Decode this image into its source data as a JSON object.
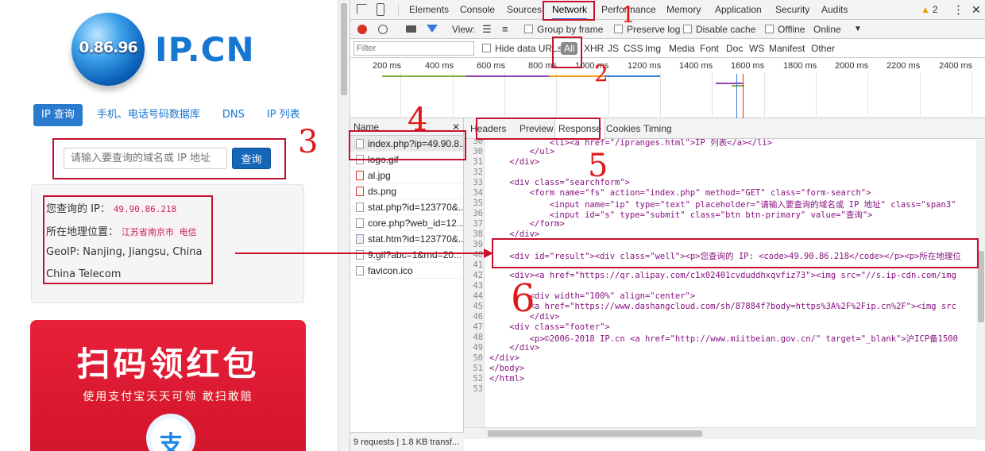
{
  "site": {
    "logo_globe_text": "0.86.96",
    "logo_text": "IP.CN",
    "nav": [
      "IP 查询",
      "手机、电话号码数据库",
      "DNS",
      "IP 列表"
    ],
    "search_placeholder": "请输入要查询的域名或 IP 地址",
    "search_button": "查询",
    "result": {
      "ip_label": "您查询的 IP：",
      "ip_value": "49.90.86.218",
      "location_label": "所在地理位置：",
      "location_value": "江苏省南京市  电信",
      "geoip": "GeoIP: Nanjing, Jiangsu, China",
      "isp": "China Telecom"
    },
    "ad": {
      "title": "扫码领红包",
      "subtitle": "使用支付宝天天可领  敢扫敢赔",
      "icon_text": "支"
    }
  },
  "devtools": {
    "tabs": [
      "Elements",
      "Console",
      "Sources",
      "Network",
      "Performance",
      "Memory",
      "Application",
      "Security",
      "Audits"
    ],
    "warning_count": "2",
    "toolbar": {
      "view_label": "View:",
      "group_by_frame": "Group by frame",
      "preserve_log": "Preserve log",
      "disable_cache": "Disable cache",
      "offline": "Offline",
      "online": "Online"
    },
    "filter": {
      "placeholder": "Filter",
      "hide_data_urls": "Hide data URLs",
      "types": [
        "All",
        "XHR",
        "JS",
        "CSS",
        "Img",
        "Media",
        "Font",
        "Doc",
        "WS",
        "Manifest",
        "Other"
      ]
    },
    "timeline_ticks": [
      "200 ms",
      "400 ms",
      "600 ms",
      "800 ms",
      "1000 ms",
      "1200 ms",
      "1400 ms",
      "1600 ms",
      "1800 ms",
      "2000 ms",
      "2200 ms",
      "2400 ms"
    ],
    "names_header": "Name",
    "requests": [
      "index.php?ip=49.90.8...",
      "logo.gif",
      "al.jpg",
      "ds.png",
      "stat.php?id=123770&...",
      "core.php?web_id=12...",
      "stat.htm?id=123770&...",
      "9.gif?abc=1&rnd=20...",
      "favicon.ico"
    ],
    "footer": "9 requests  |  1.8 KB transf...",
    "detail_tabs": [
      "Headers",
      "Preview",
      "Response",
      "Cookies",
      "Timing"
    ],
    "code_lines": [
      {
        "n": "30",
        "t": "            <li><a href=\"/ipranges.html\">IP 列表</a></li>"
      },
      {
        "n": "30",
        "t": "        </ul>"
      },
      {
        "n": "31",
        "t": "    </div>"
      },
      {
        "n": "32",
        "t": ""
      },
      {
        "n": "33",
        "t": "    <div class=\"searchform\">"
      },
      {
        "n": "34",
        "t": "        <form name=\"fs\" action=\"index.php\" method=\"GET\" class=\"form-search\">"
      },
      {
        "n": "35",
        "t": "            <input name=\"ip\" type=\"text\" placeholder=\"请输入要查询的域名或 IP 地址\" class=\"span3\""
      },
      {
        "n": "36",
        "t": "            <input id=\"s\" type=\"submit\" class=\"btn btn-primary\" value=\"查询\">"
      },
      {
        "n": "37",
        "t": "        </form>"
      },
      {
        "n": "38",
        "t": "    </div>"
      },
      {
        "n": "39",
        "t": ""
      },
      {
        "n": "40",
        "t": "    <div id=\"result\"><div class=\"well\"><p>您查询的 IP: <code>49.90.86.218</code></p><p>所在地理位"
      },
      {
        "n": "41",
        "t": ""
      },
      {
        "n": "42",
        "t": "    <div><a href=\"https://qr.alipay.com/c1x02401cvduddhxqvfiz73\"><img src=\"//s.ip-cdn.com/img"
      },
      {
        "n": "43",
        "t": ""
      },
      {
        "n": "44",
        "t": "        <div width=\"100%\" align=\"center\">"
      },
      {
        "n": "45",
        "t": "        <a href=\"https://www.dashangcloud.com/sh/87884f?body=https%3A%2F%2Fip.cn%2F\"><img src"
      },
      {
        "n": "46",
        "t": "        </div>"
      },
      {
        "n": "47",
        "t": "    <div class=\"footer\">"
      },
      {
        "n": "48",
        "t": "        <p>©2006-2018 IP.cn <a href=\"http://www.miitbeian.gov.cn/\" target=\"_blank\">沪ICP备1500"
      },
      {
        "n": "49",
        "t": "    </div>"
      },
      {
        "n": "50",
        "t": "</div>"
      },
      {
        "n": "51",
        "t": "</body>"
      },
      {
        "n": "52",
        "t": "</html>"
      },
      {
        "n": "53",
        "t": ""
      }
    ]
  },
  "annotations": [
    "1",
    "2",
    "3",
    "4",
    "5",
    "6"
  ],
  "colors": {
    "accent": "#3879d9",
    "annotation": "#e01818",
    "link": "#1a75cf"
  }
}
